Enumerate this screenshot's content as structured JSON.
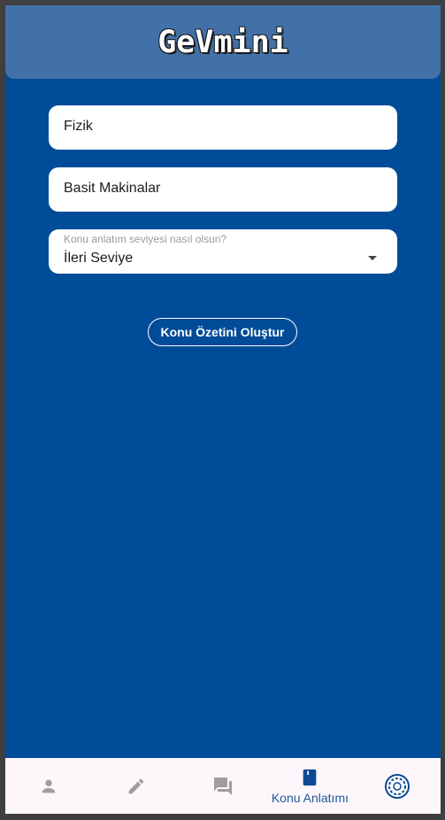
{
  "app": {
    "title": "GeVmini"
  },
  "form": {
    "subject_value": "Fizik",
    "topic_value": "Basit Makinalar",
    "level_label": "Konu anlatım seviyesi nasıl olsun?",
    "level_value": "İleri Seviye",
    "submit_label": "Konu Özetini Oluştur"
  },
  "nav": {
    "items": [
      {
        "icon": "person-icon",
        "label": ""
      },
      {
        "icon": "pencil-icon",
        "label": ""
      },
      {
        "icon": "chat-icon",
        "label": ""
      },
      {
        "icon": "book-icon",
        "label": "Konu Anlatımı",
        "active": true
      },
      {
        "icon": "gemini-logo-icon",
        "label": ""
      }
    ]
  },
  "colors": {
    "background": "#004c99",
    "appbar": "#4271a9",
    "active_nav": "#0c4a94",
    "inactive_nav": "#9e9e9e",
    "navbar_bg": "#fdf6fb"
  }
}
